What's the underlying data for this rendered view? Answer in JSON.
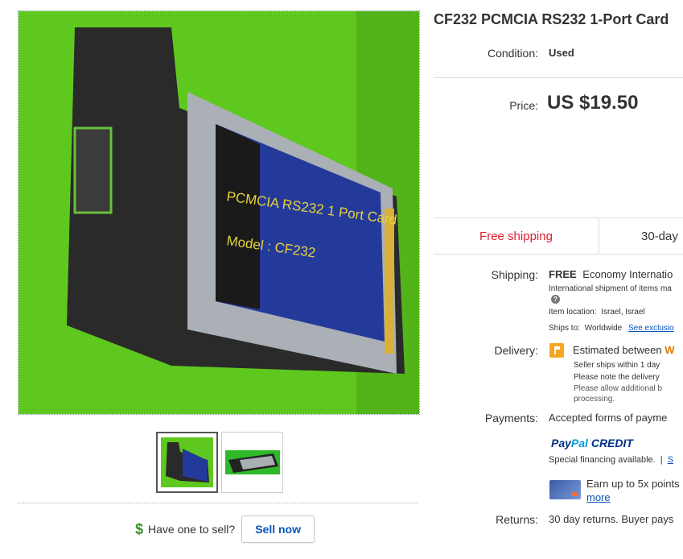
{
  "item": {
    "title": "CF232 PCMCIA RS232 1-Port Card",
    "condition_label": "Condition:",
    "condition_value": "Used",
    "price_label": "Price:",
    "price_value": "US $19.50"
  },
  "image": {
    "card_line1": "PCMCIA RS232 1 Port Card",
    "card_line2": "Model : CF232",
    "thumbnail_count": 2
  },
  "shipping_summary": {
    "free_label": "Free shipping",
    "returns_label": "30-day"
  },
  "shipping": {
    "label": "Shipping:",
    "free": "FREE",
    "method": "Economy Internatio",
    "note": "International shipment of items ma",
    "location_label": "Item location:",
    "location_value": "Israel, Israel",
    "ships_to_label": "Ships to:",
    "ships_to_value": "Worldwide",
    "exclusions_link": "See exclusio"
  },
  "delivery": {
    "label": "Delivery:",
    "estimated": "Estimated between",
    "estimated_highlight": "W",
    "line1": "Seller ships within 1 day",
    "line2": "Please note the delivery",
    "line3": "Please allow additional b",
    "line4": "processing."
  },
  "payments": {
    "label": "Payments:",
    "accepted": "Accepted forms of payme",
    "paypal_part1": "Pay",
    "paypal_part2": "Pal",
    "paypal_part3": "CREDIT",
    "financing": "Special financing available.",
    "financing_sep": "|",
    "financing_link": "S",
    "earn": "Earn up to 5x points",
    "more_link": "more"
  },
  "returns": {
    "label": "Returns:",
    "value": "30 day returns. Buyer pays"
  },
  "sell": {
    "question": "Have one to sell?",
    "button": "Sell now"
  },
  "colors": {
    "link": "#0654ba",
    "free_shipping": "#dd1e31",
    "green_bg": "#5fc81e"
  }
}
